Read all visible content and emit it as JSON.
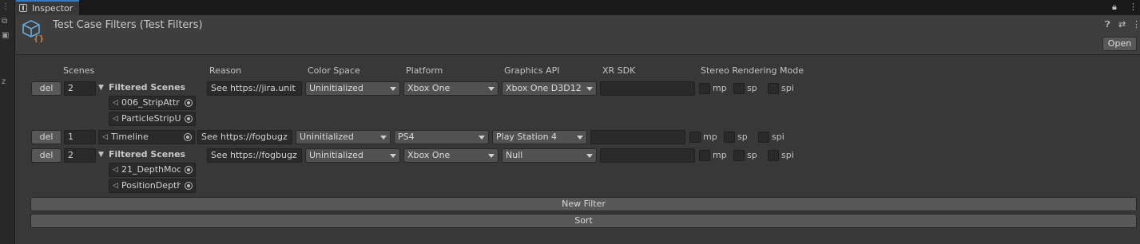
{
  "window": {
    "tab_title": "Inspector"
  },
  "header": {
    "title": "Test Case Filters (Test Filters)",
    "open_label": "Open"
  },
  "columns": {
    "scenes": "Scenes",
    "reason": "Reason",
    "color_space": "Color Space",
    "platform": "Platform",
    "graphics_api": "Graphics API",
    "xr_sdk": "XR SDK",
    "stereo": "Stereo Rendering Mode"
  },
  "rows": [
    {
      "del_label": "del",
      "count": "2",
      "foldout": "Filtered Scenes",
      "scenes": [
        "006_StripAttr",
        "ParticleStripU"
      ],
      "reason": "See https://jira.unit",
      "color_space": "Uninitialized",
      "platform": "Xbox One",
      "graphics_api": "Xbox One D3D12",
      "xr_sdk": "",
      "mp": "mp",
      "sp": "sp",
      "spi": "spi"
    },
    {
      "del_label": "del",
      "count": "1",
      "scene": "Timeline",
      "reason": "See https://fogbugz",
      "color_space": "Uninitialized",
      "platform": "PS4",
      "graphics_api": "Play Station 4",
      "xr_sdk": "",
      "mp": "mp",
      "sp": "sp",
      "spi": "spi"
    },
    {
      "del_label": "del",
      "count": "2",
      "foldout": "Filtered Scenes",
      "scenes": [
        "21_DepthMod",
        "PositionDepth"
      ],
      "reason": "See https://fogbugz",
      "color_space": "Uninitialized",
      "platform": "Xbox One",
      "graphics_api": "Null",
      "xr_sdk": "",
      "mp": "mp",
      "sp": "sp",
      "spi": "spi"
    }
  ],
  "actions": {
    "new_filter": "New Filter",
    "sort": "Sort"
  },
  "colors": {
    "background": "#383838",
    "accent": "#3a79bb",
    "scene_icon": "#6ab0e8",
    "brace_icon": "#e07a3a"
  }
}
